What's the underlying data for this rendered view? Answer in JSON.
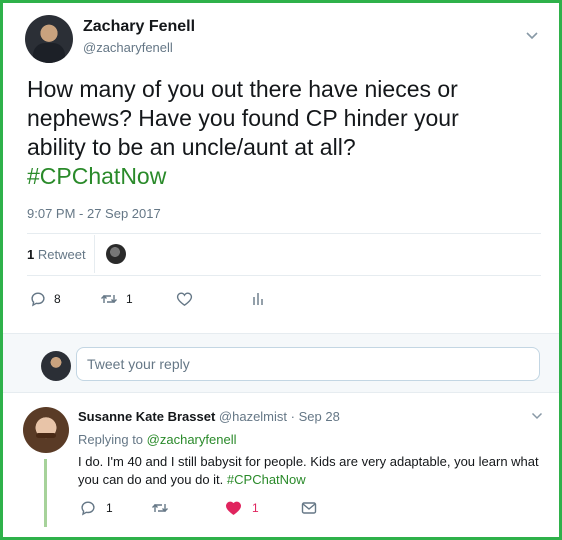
{
  "colors": {
    "frame_border": "#2fb14a",
    "hashtag": "#2a8a2a",
    "muted": "#657786",
    "like_active": "#e0245e"
  },
  "tweet": {
    "author_name": "Zachary Fenell",
    "author_handle": "@zacharyfenell",
    "text_lines": [
      "How many of you out there have nieces or",
      "nephews? Have you found CP hinder your",
      "ability to be an uncle/aunt at all?"
    ],
    "hashtag": "#CPChatNow",
    "timestamp": "9:07 PM - 27 Sep 2017",
    "retweet_stat_count": "1",
    "retweet_stat_label": "Retweet",
    "actions": {
      "reply_icon": "reply-icon",
      "reply_count": "8",
      "retweet_icon": "retweet-icon",
      "retweet_count": "1",
      "like_icon": "heart-icon",
      "analytics_icon": "analytics-icon"
    }
  },
  "reply_box": {
    "placeholder": "Tweet your reply"
  },
  "reply": {
    "author_name": "Susanne Kate Brasset",
    "author_handle": "@hazelmist",
    "date_separator": "·",
    "date": "Sep 28",
    "replying_prefix": "Replying to",
    "replying_to": "@zacharyfenell",
    "text": "I do. I'm 40 and I still babysit for people. Kids are very adaptable, you learn what you can do and you do it.",
    "hashtag": "#CPChatNow",
    "actions": {
      "reply_count": "1",
      "like_count": "1",
      "like_liked": true,
      "message_icon": "envelope-icon"
    }
  }
}
